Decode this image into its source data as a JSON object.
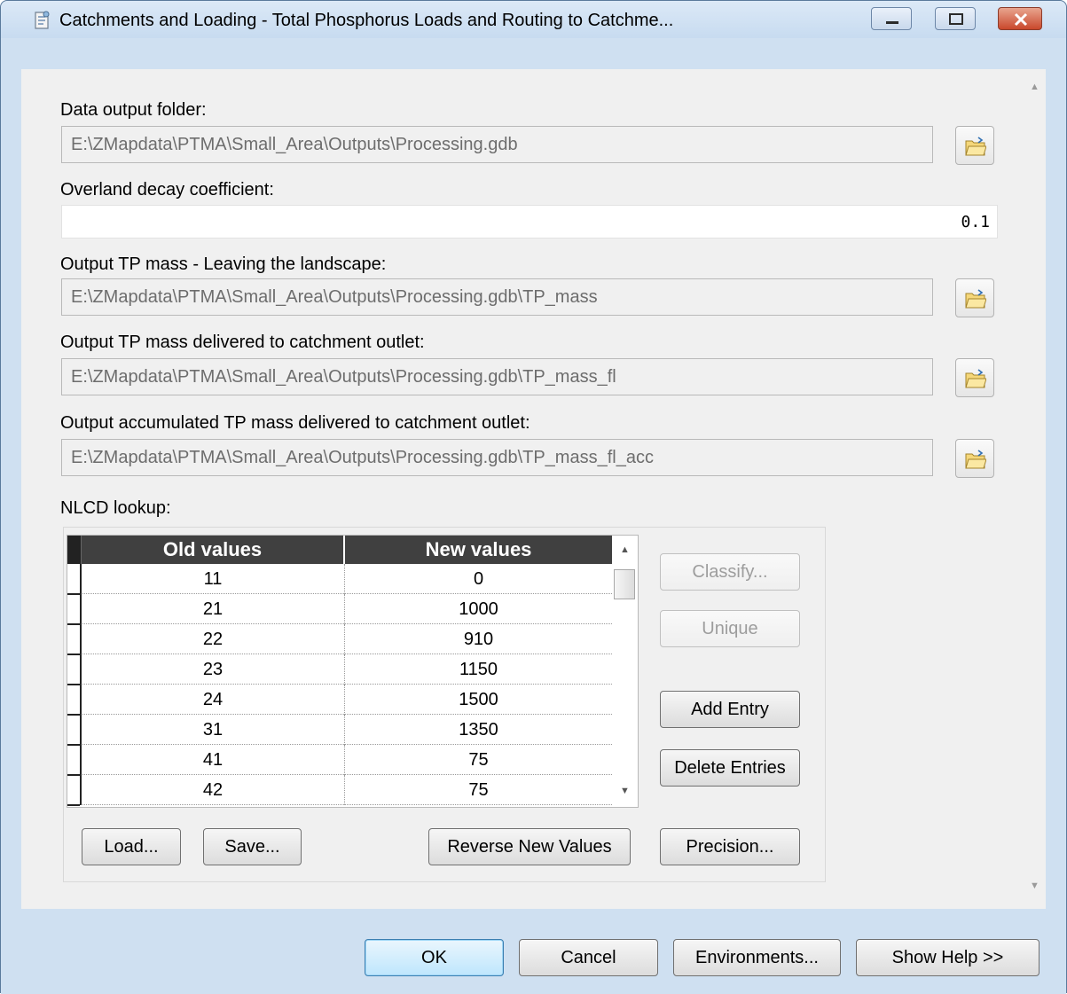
{
  "window": {
    "title": "Catchments and Loading - Total Phosphorus Loads and Routing to Catchme..."
  },
  "fields": {
    "data_output_folder": {
      "label": "Data output folder:",
      "value": "E:\\ZMapdata\\PTMA\\Small_Area\\Outputs\\Processing.gdb"
    },
    "overland_decay": {
      "label": "Overland decay coefficient:",
      "value": "0.1"
    },
    "tp_mass_leaving": {
      "label": "Output TP mass - Leaving the landscape:",
      "value": "E:\\ZMapdata\\PTMA\\Small_Area\\Outputs\\Processing.gdb\\TP_mass"
    },
    "tp_mass_delivered": {
      "label": "Output TP mass delivered to catchment outlet:",
      "value": "E:\\ZMapdata\\PTMA\\Small_Area\\Outputs\\Processing.gdb\\TP_mass_fl"
    },
    "tp_mass_accumulated": {
      "label": "Output accumulated TP mass delivered to catchment outlet:",
      "value": "E:\\ZMapdata\\PTMA\\Small_Area\\Outputs\\Processing.gdb\\TP_mass_fl_acc"
    }
  },
  "nlcd": {
    "label": "NLCD lookup:",
    "columns": [
      "Old values",
      "New values"
    ],
    "rows": [
      [
        "11",
        "0"
      ],
      [
        "21",
        "1000"
      ],
      [
        "22",
        "910"
      ],
      [
        "23",
        "1150"
      ],
      [
        "24",
        "1500"
      ],
      [
        "31",
        "1350"
      ],
      [
        "41",
        "75"
      ],
      [
        "42",
        "75"
      ]
    ],
    "buttons": {
      "classify": "Classify...",
      "unique": "Unique",
      "add_entry": "Add Entry",
      "delete_entries": "Delete Entries",
      "load": "Load...",
      "save": "Save...",
      "reverse": "Reverse New Values",
      "precision": "Precision..."
    }
  },
  "footer": {
    "ok": "OK",
    "cancel": "Cancel",
    "environments": "Environments...",
    "show_help": "Show Help >>"
  }
}
